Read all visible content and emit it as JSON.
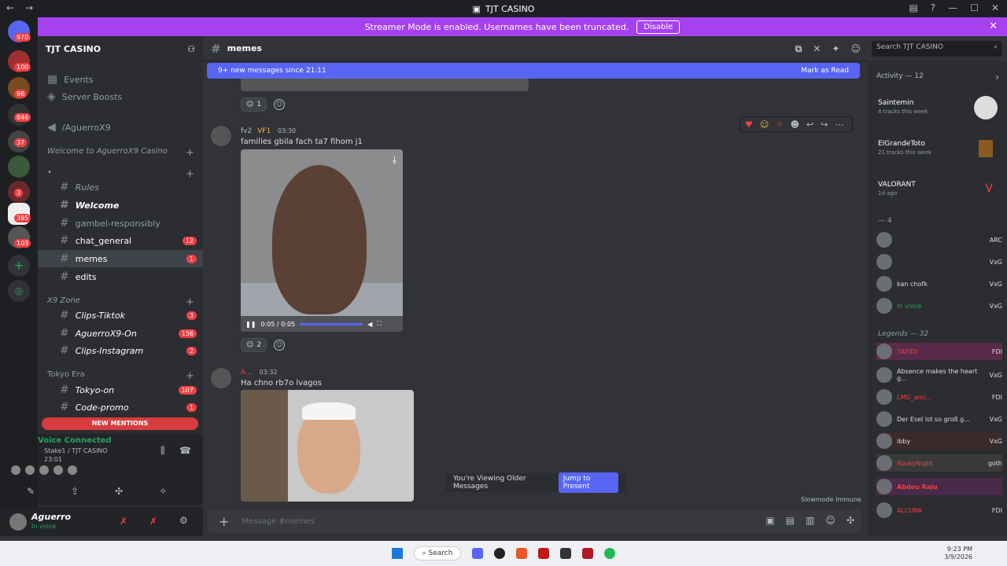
{
  "window": {
    "title": "TJT CASINO"
  },
  "banner": {
    "text": "Streamer Mode is enabled. Usernames have been truncated.",
    "button": "Disable"
  },
  "server": {
    "name": "TJT CASINO"
  },
  "guild_badges": [
    "970",
    "100",
    "96",
    "846",
    "37",
    "3",
    "395",
    "103"
  ],
  "sidebar": {
    "events": "Events",
    "boosts": "Server Boosts",
    "user_channel": "/AguerroX9",
    "welcome_cat": "Welcome to AguerroX9 Casino",
    "cat2": "•",
    "channels": [
      {
        "label": "Rules",
        "count": ""
      },
      {
        "label": "Welcome",
        "count": ""
      },
      {
        "label": "gambel-responsibly",
        "count": ""
      },
      {
        "label": "chat_general",
        "count": "12"
      },
      {
        "label": "memes",
        "count": "1"
      },
      {
        "label": "edits",
        "count": ""
      }
    ],
    "x9zone": "X9 Zone",
    "zone_channels": [
      {
        "label": "Clips-Tiktok",
        "count": "3"
      },
      {
        "label": "AguerroX9-On",
        "count": "156"
      },
      {
        "label": "Clips-Instagram",
        "count": "2"
      }
    ],
    "tokyo": "Tokyo Era",
    "tokyo_channels": [
      {
        "label": "Tokyo-on",
        "count": "107"
      },
      {
        "label": "Code-promo",
        "count": "1"
      }
    ],
    "new_mentions": "NEW MENTIONS"
  },
  "voice": {
    "title": "Voice Connected",
    "sub": "Stake1 / TJT CASINO",
    "time": "23:01"
  },
  "user": {
    "name": "Aguerro",
    "status": "In voice"
  },
  "channel": {
    "name": "memes"
  },
  "search": {
    "placeholder": "Search TJT CASINO"
  },
  "newbar": {
    "text": "9+ new messages since 21:11",
    "action": "Mark as Read"
  },
  "messages": [
    {
      "name": "fv2",
      "badge": "VF1",
      "time": "03:30",
      "text": "families gbila fach ta7 fihom j1",
      "video_time": "0:05 / 0:05",
      "react_count": "2"
    },
    {
      "name": "A...",
      "time": "03:32",
      "text": "Ha chno rb7o lvagos"
    }
  ],
  "top_react_count": "1",
  "older": {
    "text": "You're Viewing Older Messages",
    "button": "Jump to Present"
  },
  "slowmode": "Slowmode Immune",
  "composer": {
    "placeholder": "Message #memes"
  },
  "activity": {
    "title": "Activity — 12",
    "items": [
      {
        "name": "Saintemin",
        "sub": "4 tracks this week"
      },
      {
        "name": "ElGrandeToto",
        "sub": "21 tracks this week"
      },
      {
        "name": "VALORANT",
        "sub": "1d ago"
      }
    ]
  },
  "group1": {
    "title": "— 4",
    "members": [
      {
        "name": "",
        "tag": "ARC"
      },
      {
        "name": "",
        "tag": "VxG"
      },
      {
        "name": "kan chofk",
        "tag": "VxG"
      },
      {
        "name": "In voice",
        "tag": "VxG"
      }
    ]
  },
  "group2": {
    "title": "Legends — 32",
    "members": [
      {
        "name": "7AFIDI",
        "tag": "FDI"
      },
      {
        "name": "Absence makes the heart g...",
        "tag": "VxG"
      },
      {
        "name": "LMG_ami...",
        "tag": "FDI"
      },
      {
        "name": "Der Esel ist so groß g...",
        "tag": "VxG"
      },
      {
        "name": "ibby",
        "tag": "VxG"
      },
      {
        "name": "RoukyNight",
        "tag": "goth"
      },
      {
        "name": "Abdou Raju",
        "tag": ""
      },
      {
        "name": "ALCURA",
        "tag": "FDI"
      }
    ]
  },
  "taskbar": {
    "search": "Search",
    "time": "9:23 PM",
    "date": "3/9/2026"
  },
  "colors": {
    "accent": "#5865f2",
    "banner": "#a641f0",
    "mention": "#f23f43"
  }
}
